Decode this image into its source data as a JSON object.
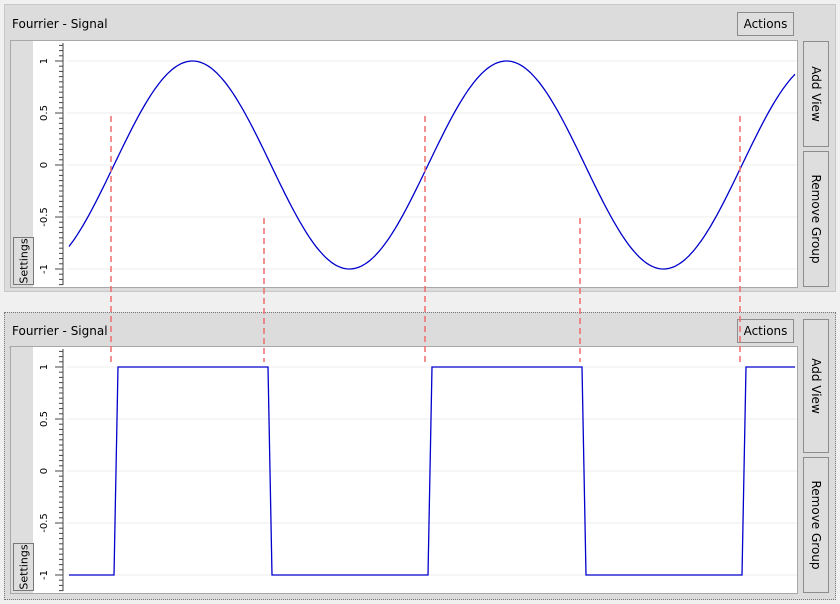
{
  "views": [
    {
      "title": "Fourrier - Signal",
      "actions_label": "Actions",
      "settings_label": "Settings",
      "add_view_label": "Add View",
      "remove_group_label": "Remove Group",
      "y_ticks": [
        "1",
        "0.5",
        "0",
        "-0.5",
        "-1"
      ]
    },
    {
      "title": "Fourrier - Signal",
      "actions_label": "Actions",
      "settings_label": "Settings",
      "add_view_label": "Add View",
      "remove_group_label": "Remove Group",
      "y_ticks": [
        "1",
        "0.5",
        "0",
        "-0.5",
        "-1"
      ]
    }
  ],
  "colors": {
    "signal": "#0000cc",
    "marker": "#ef6b6b"
  },
  "chart_data": [
    {
      "type": "line",
      "series": [
        {
          "shape": "sine",
          "amplitude": 1,
          "cycles_visible": 2.4
        }
      ],
      "ylim": [
        -1,
        1
      ],
      "yticks": [
        1,
        0.5,
        0,
        -0.5,
        -1
      ]
    },
    {
      "type": "line",
      "series": [
        {
          "shape": "square",
          "levels": [
            -1,
            1
          ],
          "cycles_visible": 2.4
        }
      ],
      "ylim": [
        -1,
        1
      ],
      "yticks": [
        1,
        0.5,
        0,
        -0.5,
        -1
      ]
    }
  ]
}
